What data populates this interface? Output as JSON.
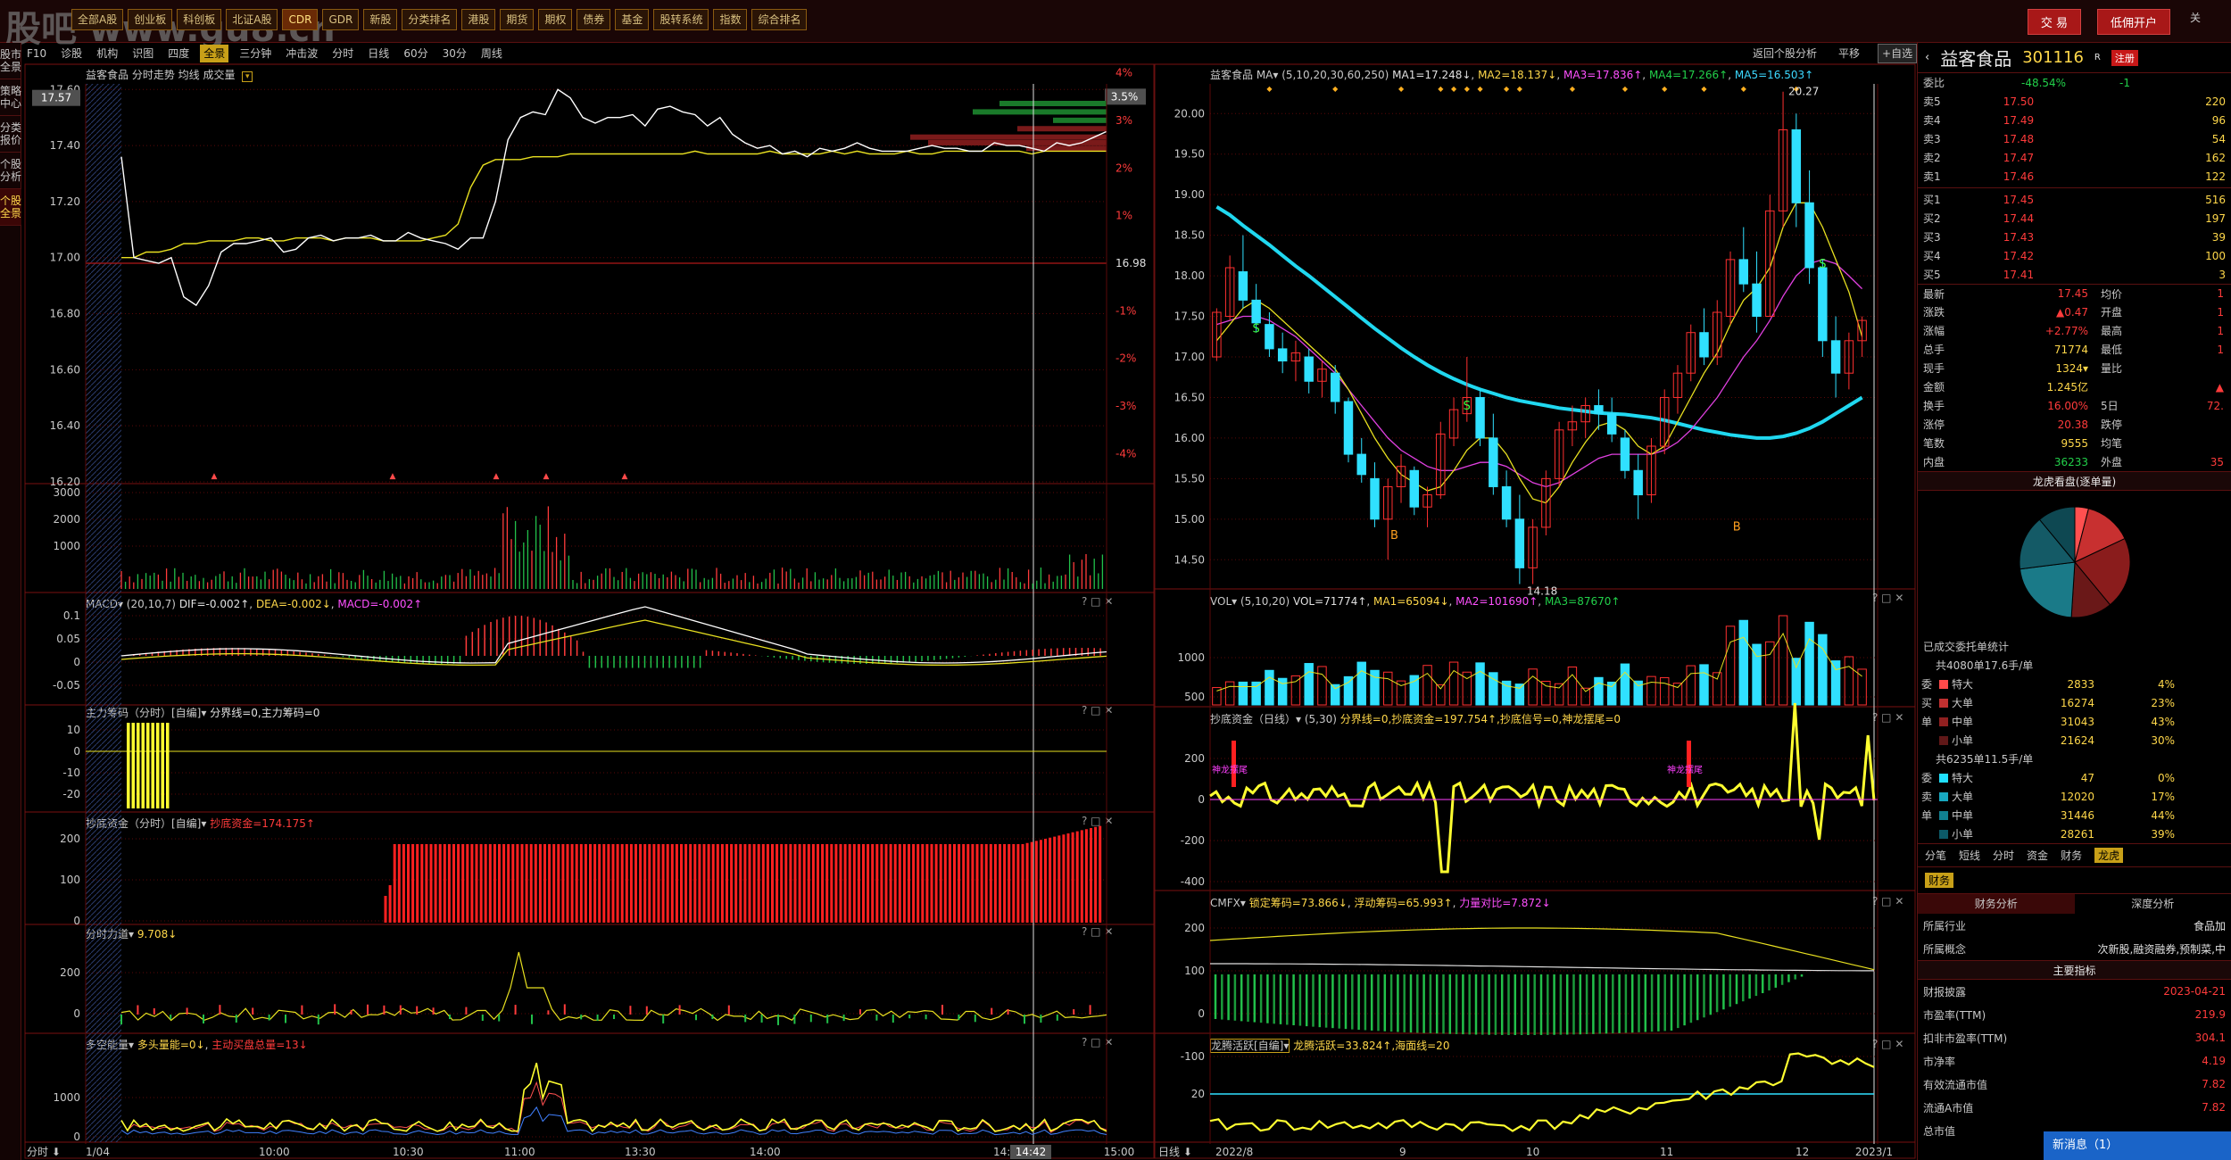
{
  "watermark": "股吧 www.gu8.cn",
  "menu": [
    "全部A股",
    "创业板",
    "科创板",
    "北证A股",
    "CDR",
    "GDR",
    "新股",
    "分类排名",
    "港股",
    "期货",
    "期权",
    "债券",
    "基金",
    "股转系统",
    "指数",
    "综合排名"
  ],
  "menu_selected": 4,
  "account": {
    "trade": "交 易",
    "open": "低佣开户",
    "extra": "关"
  },
  "left_strip": [
    "股市全景",
    "策略中心",
    "分类报价",
    "个股分析",
    "个股全景"
  ],
  "left_strip_active": 4,
  "toolbar": [
    "F10",
    "诊股",
    "机构",
    "识图",
    "四度",
    "全景",
    "三分钟",
    "冲击波",
    "分时",
    "日线",
    "60分",
    "30分",
    "周线"
  ],
  "toolbar_selected": 5,
  "right_toolbar": {
    "back": "返回个股分析",
    "flat": "平移",
    "zixuan": "+自选"
  },
  "intraday": {
    "title": "益客食品  分时走势  均线  成交量",
    "price_label": "17.57",
    "pct_label": "3.5%",
    "prev_close": "16.98",
    "y_left": [
      "17.60",
      "17.40",
      "17.20",
      "17.00",
      "16.80",
      "16.60",
      "16.40",
      "16.20"
    ],
    "y_right": [
      "4%",
      "3%",
      "2%",
      "1%",
      "",
      "-1%",
      "-2%",
      "-3%",
      "-4%"
    ],
    "prices": [
      17.36,
      17.0,
      16.99,
      16.98,
      17.0,
      16.86,
      16.83,
      16.9,
      17.02,
      17.05,
      17.05,
      17.06,
      17.07,
      17.02,
      17.03,
      17.07,
      17.08,
      17.06,
      17.07,
      17.07,
      17.08,
      17.06,
      17.06,
      17.09,
      17.07,
      17.06,
      17.05,
      17.03,
      17.07,
      17.07,
      17.2,
      17.42,
      17.5,
      17.52,
      17.51,
      17.6,
      17.57,
      17.5,
      17.48,
      17.5,
      17.5,
      17.51,
      17.47,
      17.53,
      17.54,
      17.52,
      17.51,
      17.47,
      17.5,
      17.44,
      17.41,
      17.39,
      17.4,
      17.37,
      17.38,
      17.36,
      17.39,
      17.38,
      17.39,
      17.41,
      17.39,
      17.38,
      17.38,
      17.38,
      17.39,
      17.4,
      17.39,
      17.39,
      17.38,
      17.38,
      17.41,
      17.4,
      17.4,
      17.39,
      17.38,
      17.41,
      17.4,
      17.41,
      17.43,
      17.45
    ],
    "avg": [
      17.0,
      17.0,
      17.02,
      17.02,
      17.03,
      17.05,
      17.05,
      17.06,
      17.06,
      17.06,
      17.07,
      17.07,
      17.06,
      17.06,
      17.07,
      17.07,
      17.07,
      17.06,
      17.07,
      17.07,
      17.07,
      17.06,
      17.06,
      17.06,
      17.06,
      17.07,
      17.08,
      17.12,
      17.25,
      17.33,
      17.35,
      17.35,
      17.35,
      17.36,
      17.36,
      17.36,
      17.37,
      17.37,
      17.37,
      17.37,
      17.37,
      17.37,
      17.37,
      17.37,
      17.37,
      17.37,
      17.38,
      17.37,
      17.37,
      17.37,
      17.37,
      17.37,
      17.38,
      17.37,
      17.37,
      17.37,
      17.37,
      17.38,
      17.37,
      17.38,
      17.37,
      17.37,
      17.37,
      17.38,
      17.37,
      17.37,
      17.38,
      17.38,
      17.38,
      17.38,
      17.38,
      17.38,
      17.38,
      17.37,
      17.38,
      17.38,
      17.38,
      17.38,
      17.38,
      17.38
    ],
    "x_axis": [
      "1/04",
      "10:00",
      "10:30",
      "11:00",
      "13:30",
      "14:00",
      "14:30",
      "14:42",
      "15:00"
    ],
    "vol_y": [
      "3000",
      "2000",
      "1000"
    ]
  },
  "macd": {
    "title": "MACD▾ (20,10,7)",
    "dif": "DIF=-0.002↑",
    "dea": "DEA=-0.002↓",
    "macd": "MACD=-0.002↑",
    "y": [
      "0.1",
      "0.05",
      "0",
      "-0.05"
    ]
  },
  "zhuli": {
    "title": "主力筹码（分时）[自编]▾",
    "val": "分界线=0,主力筹码=0",
    "y": [
      "10",
      "0",
      "-10",
      "-20"
    ]
  },
  "chaodi_intra": {
    "title": "抄底资金（分时）[自编]▾",
    "val": "抄底资金=174.175↑",
    "y": [
      "200",
      "100",
      "0"
    ]
  },
  "fenshi": {
    "title": "分时力道▾",
    "val": "9.708↓",
    "y": [
      "200",
      "0"
    ]
  },
  "duokong": {
    "title": "多空能量▾",
    "val1": "多头量能=0↓",
    "val2": "主动买盘总量=13↓",
    "y": [
      "1000",
      "0"
    ]
  },
  "candles": {
    "title": "益客食品  MA▾",
    "params": "(5,10,20,30,60,250)",
    "ma1": "MA1=17.248↓",
    "ma2": "MA2=18.137↓",
    "ma3": "MA3=17.836↑",
    "ma4": "MA4=17.266↑",
    "ma5": "MA5=16.503↑",
    "y": [
      "20.00",
      "19.50",
      "19.00",
      "18.50",
      "18.00",
      "17.50",
      "17.00",
      "16.50",
      "16.00",
      "15.50",
      "15.00",
      "14.50"
    ],
    "ylim": [
      14.25,
      20.3
    ],
    "high_label": "20.27",
    "low_label": "14.18",
    "ohlc": [
      [
        17.0,
        17.6,
        16.95,
        17.55
      ],
      [
        17.5,
        18.25,
        17.45,
        18.1
      ],
      [
        18.05,
        18.5,
        17.6,
        17.7
      ],
      [
        17.7,
        17.9,
        17.3,
        17.42
      ],
      [
        17.4,
        17.55,
        17.0,
        17.1
      ],
      [
        17.1,
        17.3,
        16.8,
        16.95
      ],
      [
        16.95,
        17.2,
        16.7,
        17.05
      ],
      [
        17.0,
        17.1,
        16.55,
        16.7
      ],
      [
        16.7,
        16.95,
        16.5,
        16.85
      ],
      [
        16.8,
        16.9,
        16.3,
        16.45
      ],
      [
        16.45,
        16.5,
        15.7,
        15.8
      ],
      [
        15.8,
        16.0,
        15.45,
        15.55
      ],
      [
        15.5,
        15.7,
        14.9,
        15.0
      ],
      [
        15.0,
        15.5,
        14.5,
        15.4
      ],
      [
        15.4,
        15.8,
        15.2,
        15.65
      ],
      [
        15.6,
        15.65,
        15.05,
        15.15
      ],
      [
        15.15,
        15.4,
        14.9,
        15.3
      ],
      [
        15.3,
        16.2,
        15.25,
        16.05
      ],
      [
        16.0,
        16.5,
        15.9,
        16.35
      ],
      [
        16.3,
        17.0,
        16.2,
        16.5
      ],
      [
        16.5,
        16.6,
        15.9,
        16.0
      ],
      [
        16.0,
        16.3,
        15.3,
        15.4
      ],
      [
        15.4,
        15.6,
        14.9,
        15.0
      ],
      [
        15.0,
        15.3,
        14.2,
        14.4
      ],
      [
        14.4,
        15.0,
        14.2,
        14.9
      ],
      [
        14.9,
        15.6,
        14.8,
        15.5
      ],
      [
        15.5,
        16.2,
        15.4,
        16.1
      ],
      [
        16.1,
        16.4,
        15.9,
        16.2
      ],
      [
        16.2,
        16.5,
        16.0,
        16.4
      ],
      [
        16.4,
        16.6,
        16.1,
        16.3
      ],
      [
        16.3,
        16.5,
        15.95,
        16.05
      ],
      [
        16.0,
        16.1,
        15.5,
        15.6
      ],
      [
        15.6,
        15.8,
        15.0,
        15.3
      ],
      [
        15.3,
        16.0,
        15.2,
        15.9
      ],
      [
        15.9,
        16.6,
        15.8,
        16.5
      ],
      [
        16.5,
        16.9,
        16.3,
        16.8
      ],
      [
        16.8,
        17.4,
        16.7,
        17.3
      ],
      [
        17.3,
        17.6,
        16.9,
        17.0
      ],
      [
        17.0,
        17.7,
        16.9,
        17.55
      ],
      [
        17.5,
        18.3,
        17.4,
        18.2
      ],
      [
        18.2,
        18.6,
        17.8,
        17.9
      ],
      [
        17.9,
        18.3,
        17.3,
        17.5
      ],
      [
        17.5,
        19.0,
        17.5,
        18.8
      ],
      [
        18.8,
        20.27,
        18.6,
        19.8
      ],
      [
        19.8,
        20.0,
        18.6,
        18.9
      ],
      [
        18.9,
        19.3,
        17.9,
        18.1
      ],
      [
        18.1,
        18.2,
        17.0,
        17.2
      ],
      [
        17.2,
        17.5,
        16.5,
        16.8
      ],
      [
        16.8,
        17.3,
        16.6,
        17.2
      ],
      [
        17.2,
        17.5,
        17.0,
        17.45
      ]
    ],
    "ma_short": [
      17.2,
      17.4,
      17.6,
      17.7,
      17.6,
      17.45,
      17.3,
      17.15,
      17.0,
      16.85,
      16.6,
      16.3,
      16.0,
      15.75,
      15.55,
      15.45,
      15.35,
      15.4,
      15.6,
      15.85,
      16.0,
      16.0,
      15.8,
      15.5,
      15.25,
      15.2,
      15.4,
      15.7,
      15.95,
      16.15,
      16.2,
      16.1,
      15.9,
      15.8,
      15.9,
      16.2,
      16.5,
      16.8,
      17.05,
      17.4,
      17.7,
      17.85,
      18.1,
      18.6,
      18.9,
      18.9,
      18.6,
      18.2,
      17.8,
      17.25
    ],
    "ma_mid": [
      17.4,
      17.45,
      17.5,
      17.5,
      17.45,
      17.35,
      17.25,
      17.1,
      16.95,
      16.8,
      16.6,
      16.4,
      16.2,
      16.0,
      15.85,
      15.75,
      15.65,
      15.6,
      15.6,
      15.65,
      15.7,
      15.7,
      15.65,
      15.55,
      15.45,
      15.4,
      15.45,
      15.55,
      15.65,
      15.75,
      15.8,
      15.8,
      15.8,
      15.8,
      15.85,
      15.95,
      16.1,
      16.3,
      16.5,
      16.75,
      17.0,
      17.2,
      17.45,
      17.75,
      18.0,
      18.15,
      18.2,
      18.15,
      18.0,
      17.84
    ],
    "ma_long": [
      18.85,
      18.75,
      18.62,
      18.5,
      18.38,
      18.25,
      18.12,
      18.0,
      17.87,
      17.74,
      17.61,
      17.48,
      17.35,
      17.23,
      17.11,
      17.0,
      16.9,
      16.81,
      16.73,
      16.66,
      16.6,
      16.55,
      16.5,
      16.46,
      16.43,
      16.4,
      16.37,
      16.35,
      16.33,
      16.31,
      16.3,
      16.29,
      16.27,
      16.25,
      16.22,
      16.18,
      16.14,
      16.1,
      16.07,
      16.04,
      16.02,
      16.0,
      16.0,
      16.02,
      16.06,
      16.12,
      16.2,
      16.3,
      16.4,
      16.5
    ],
    "x_axis": [
      "2022/8",
      "9",
      "10",
      "11",
      "12",
      "2023/1"
    ]
  },
  "vol_panel": {
    "title": "VOL▾",
    "params": "(5,10,20)",
    "vol": "VOL=71774↑",
    "ma1": "MA1=65094↓",
    "ma2": "MA2=101690↑",
    "ma3": "MA3=87670↑",
    "y": [
      "1000",
      "500"
    ]
  },
  "chaodi_day": {
    "title": "抄底资金（日线）▾",
    "params": "(5,30)",
    "val": "分界线=0,抄底资金=197.754↑,抄底信号=0,神龙摆尾=0",
    "y": [
      "200",
      "0",
      "-200",
      "-400"
    ],
    "tag": "神龙摆尾"
  },
  "cmfx": {
    "title": "CMFX▾",
    "v1": "锁定筹码=73.866↓",
    "v2": "浮动筹码=65.993↑",
    "v3": "力量对比=7.872↓",
    "y": [
      "200",
      "100",
      "0",
      "-100"
    ]
  },
  "longteng": {
    "title": "龙腾活跃[自编]▾",
    "val": "龙腾活跃=33.824↑,海面线=20",
    "y": [
      "20"
    ]
  },
  "side": {
    "name": "益客食品",
    "code": "301116",
    "suffix": "R",
    "badge": "注册",
    "webi_label": "委比",
    "webi_val": "-48.54%",
    "webi_num": "-1",
    "sells": [
      [
        "卖5",
        "17.50",
        "220"
      ],
      [
        "卖4",
        "17.49",
        "96"
      ],
      [
        "卖3",
        "17.48",
        "54"
      ],
      [
        "卖2",
        "17.47",
        "162"
      ],
      [
        "卖1",
        "17.46",
        "122"
      ]
    ],
    "buys": [
      [
        "买1",
        "17.45",
        "516"
      ],
      [
        "买2",
        "17.44",
        "197"
      ],
      [
        "买3",
        "17.43",
        "39"
      ],
      [
        "买4",
        "17.42",
        "100"
      ],
      [
        "买5",
        "17.41",
        "3"
      ]
    ],
    "stats": [
      [
        "最新",
        "17.45",
        "均价",
        "1"
      ],
      [
        "涨跌",
        "▲0.47",
        "开盘",
        "1"
      ],
      [
        "涨幅",
        "+2.77%",
        "最高",
        "1"
      ],
      [
        "总手",
        "71774",
        "最低",
        "1"
      ],
      [
        "现手",
        "1324▾",
        "量比",
        ""
      ],
      [
        "金额",
        "1.245亿",
        "",
        "▲"
      ],
      [
        "换手",
        "16.00%",
        "5日",
        "72."
      ],
      [
        "涨停",
        "20.38",
        "跌停",
        ""
      ],
      [
        "笔数",
        "9555",
        "均笔",
        ""
      ],
      [
        "内盘",
        "36233",
        "外盘",
        "35"
      ]
    ],
    "lhk": "龙虎看盘(逐单量)",
    "pie": [
      4,
      23,
      43,
      30
    ],
    "pie_colors": [
      "#ff4a4a",
      "#b02828",
      "#7a1818",
      "#205060"
    ],
    "entrust": "已成交委托单统计",
    "buy_total": "共4080单17.6手/单",
    "buy_rows": [
      [
        "委",
        "特大",
        "2833",
        "4%"
      ],
      [
        "买",
        "大单",
        "16274",
        "23%"
      ],
      [
        "单",
        "中单",
        "31043",
        "43%"
      ],
      [
        "",
        "小单",
        "21624",
        "30%"
      ]
    ],
    "sell_total": "共6235单11.5手/单",
    "sell_rows": [
      [
        "委",
        "特大",
        "47",
        "0%"
      ],
      [
        "卖",
        "大单",
        "12020",
        "17%"
      ],
      [
        "单",
        "中单",
        "31446",
        "44%"
      ],
      [
        "",
        "小单",
        "28261",
        "39%"
      ]
    ],
    "tabs": [
      "分笔",
      "短线",
      "分时",
      "资金",
      "财务",
      "龙虎"
    ],
    "tabs_sel": 5,
    "fin": "财务",
    "fin_tabs": [
      "财务分析",
      "深度分析"
    ],
    "industry": [
      "所属行业",
      "食品加"
    ],
    "concept": [
      "所属概念",
      "次新股,融资融券,预制菜,中"
    ],
    "main_index": "主要指标",
    "metrics": [
      [
        "财报披露",
        "2023-04-21"
      ],
      [
        "市盈率(TTM)",
        "219.9"
      ],
      [
        "扣非市盈率(TTM)",
        "304.1"
      ],
      [
        "市净率",
        "4.19"
      ],
      [
        "有效流通市值",
        "7.82"
      ],
      [
        "流通A市值",
        "7.82"
      ],
      [
        "总市值",
        ""
      ]
    ]
  },
  "news": "新消息（1）"
}
